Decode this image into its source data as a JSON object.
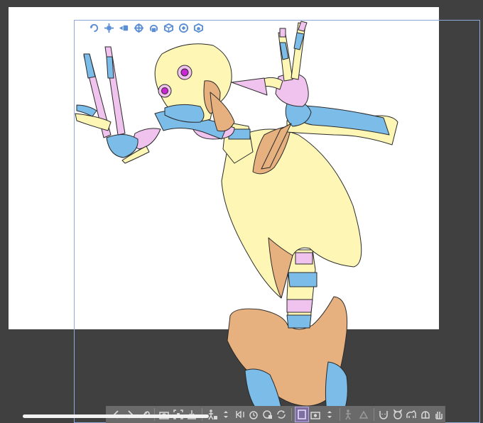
{
  "app": {
    "canvas": {
      "paper_color": "#ffffff",
      "workspace_color": "#404040",
      "frame_color": "#8fa9d8"
    },
    "figure": {
      "subject": "skeleton-3d-model",
      "palette": {
        "skull": "#fdf6b5",
        "pink": "#f0c3ee",
        "blue": "#7bbce9",
        "tan": "#e6b07f",
        "eye": "#c926d4",
        "outline": "#2a2a2a"
      }
    },
    "object_toolbar": {
      "icons": [
        "camera-rotate-icon",
        "camera-move-icon",
        "camera-zoom-icon",
        "object-move-icon",
        "object-rotate-icon",
        "object-rotate-3d-icon",
        "object-rotate-view-icon",
        "object-scale-icon"
      ]
    },
    "bottom_toolbar": {
      "icons": [
        "previous-icon",
        "next-icon",
        "wrench-icon",
        "camera-angle-icon",
        "fit-to-view-icon",
        "lay-on-floor-icon",
        "pose-icon",
        "up-down-icon",
        "reset-rotation-icon",
        "flip-icon",
        "height-icon",
        "capture-icon",
        "loop-icon",
        "register-material-icon",
        "snapshot-icon",
        "expand-icon",
        "lock-joint-icon",
        "face-icon",
        "head-icon",
        "animal-icon",
        "hand-icon",
        "gesture-icon"
      ]
    }
  }
}
